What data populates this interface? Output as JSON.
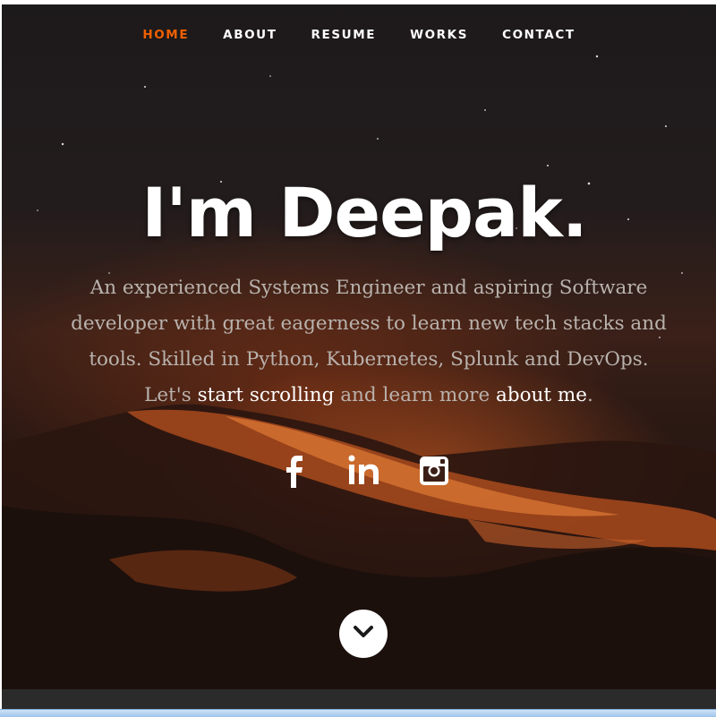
{
  "nav": {
    "items": [
      {
        "label": "HOME",
        "active": true
      },
      {
        "label": "ABOUT",
        "active": false
      },
      {
        "label": "RESUME",
        "active": false
      },
      {
        "label": "WORKS",
        "active": false
      },
      {
        "label": "CONTACT",
        "active": false
      }
    ],
    "active_color": "#f06000"
  },
  "hero": {
    "title": "I'm Deepak.",
    "intro_text": "An experienced Systems Engineer and aspiring Software developer with great eagerness to learn new tech stacks and tools. Skilled in Python, Kubernetes, Splunk and DevOps.",
    "lets": "Let's",
    "start_scrolling": "start scrolling",
    "and_learn_more": "and learn more",
    "about_me": "about me",
    "period": "."
  },
  "social": {
    "icons": [
      "facebook-icon",
      "linkedin-icon",
      "instagram-icon"
    ]
  },
  "scroll_button": {
    "icon": "chevron-down-icon"
  }
}
